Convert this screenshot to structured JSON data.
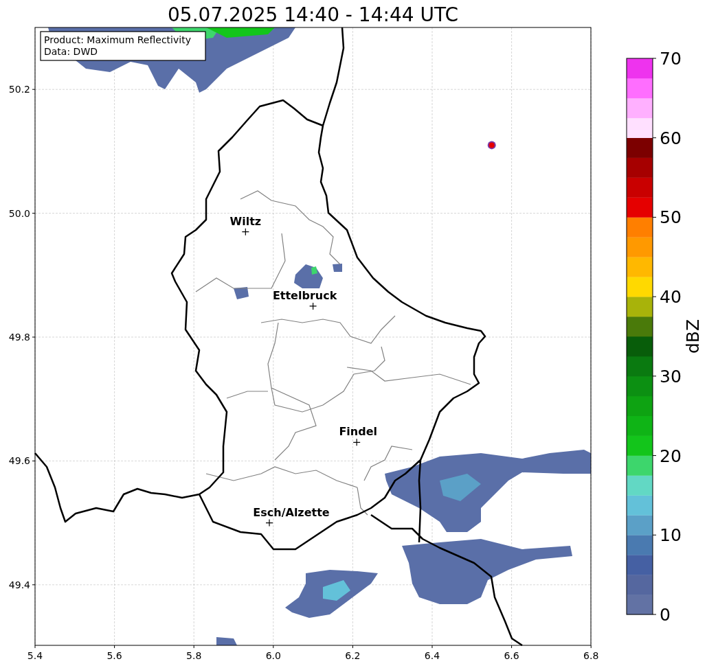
{
  "title": "05.07.2025 14:40 - 14:44 UTC",
  "info_box": {
    "lines": [
      "Product: Maximum Reflectivity",
      "Data: DWD"
    ]
  },
  "map": {
    "x_ticks": [
      "5.4",
      "5.6",
      "5.8",
      "6.0",
      "6.2",
      "6.4",
      "6.6",
      "6.8"
    ],
    "y_ticks": [
      "50.2",
      "50.0",
      "49.8",
      "49.6",
      "49.4"
    ],
    "places": [
      {
        "name": "Wiltz"
      },
      {
        "name": "Ettelbruck"
      },
      {
        "name": "Findel"
      },
      {
        "name": "Esch/Alzette"
      }
    ]
  },
  "colorbar": {
    "label": "dBZ",
    "ticks": [
      "70",
      "60",
      "50",
      "40",
      "30",
      "20",
      "10",
      "0"
    ],
    "segments": [
      {
        "color": "#6272a4"
      },
      {
        "color": "#55679f"
      },
      {
        "color": "#4560a3"
      },
      {
        "color": "#4a7ab0"
      },
      {
        "color": "#5ba0c7"
      },
      {
        "color": "#63c1d9"
      },
      {
        "color": "#62d8c4"
      },
      {
        "color": "#3dd66c"
      },
      {
        "color": "#13c51b"
      },
      {
        "color": "#0fb416"
      },
      {
        "color": "#0ea312"
      },
      {
        "color": "#0c9012"
      },
      {
        "color": "#0a7a10"
      },
      {
        "color": "#085d0a"
      },
      {
        "color": "#4a7a0a"
      },
      {
        "color": "#a8b30a"
      },
      {
        "color": "#ffd900"
      },
      {
        "color": "#ffb800"
      },
      {
        "color": "#ff9900"
      },
      {
        "color": "#ff7f00"
      },
      {
        "color": "#e50000"
      },
      {
        "color": "#c90000"
      },
      {
        "color": "#a60000"
      },
      {
        "color": "#7c0000"
      },
      {
        "color": "#ffe0ff"
      },
      {
        "color": "#ffb0ff"
      },
      {
        "color": "#ff6eff"
      },
      {
        "color": "#ee33ee"
      }
    ]
  }
}
